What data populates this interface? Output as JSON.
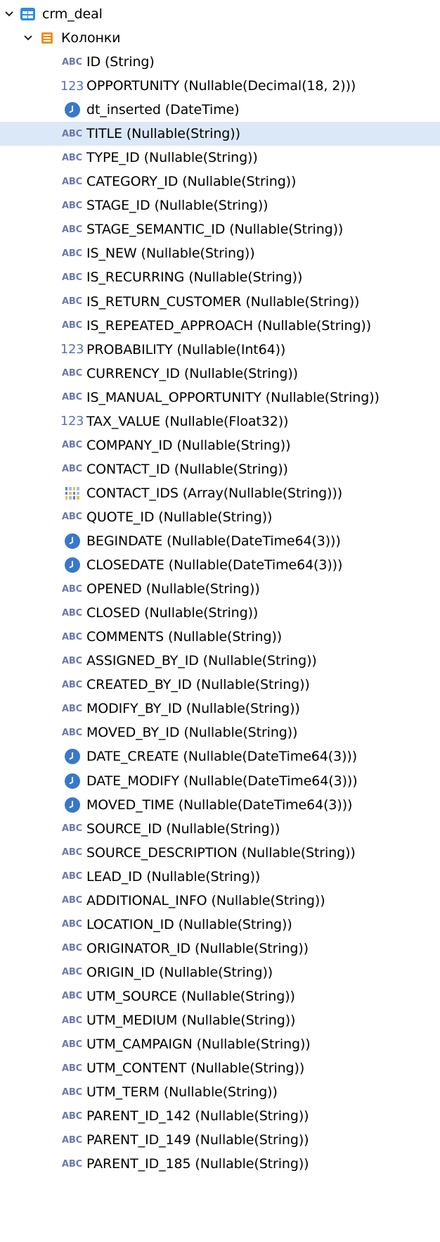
{
  "tree": {
    "root": {
      "label": "crm_deal",
      "icon": "table-icon",
      "expanded": true
    },
    "folder": {
      "label": "Колонки",
      "icon": "columns-folder-icon",
      "expanded": true
    },
    "selected_column": "TITLE (Nullable(String))",
    "columns": [
      {
        "type_icon": "string-icon",
        "type_text": "ABC",
        "label": "ID (String)"
      },
      {
        "type_icon": "number-icon",
        "type_text": "123",
        "label": "OPPORTUNITY (Nullable(Decimal(18, 2)))"
      },
      {
        "type_icon": "datetime-icon",
        "type_text": "",
        "label": "dt_inserted (DateTime)"
      },
      {
        "type_icon": "string-icon",
        "type_text": "ABC",
        "label": "TITLE (Nullable(String))"
      },
      {
        "type_icon": "string-icon",
        "type_text": "ABC",
        "label": "TYPE_ID (Nullable(String))"
      },
      {
        "type_icon": "string-icon",
        "type_text": "ABC",
        "label": "CATEGORY_ID (Nullable(String))"
      },
      {
        "type_icon": "string-icon",
        "type_text": "ABC",
        "label": "STAGE_ID (Nullable(String))"
      },
      {
        "type_icon": "string-icon",
        "type_text": "ABC",
        "label": "STAGE_SEMANTIC_ID (Nullable(String))"
      },
      {
        "type_icon": "string-icon",
        "type_text": "ABC",
        "label": "IS_NEW (Nullable(String))"
      },
      {
        "type_icon": "string-icon",
        "type_text": "ABC",
        "label": "IS_RECURRING (Nullable(String))"
      },
      {
        "type_icon": "string-icon",
        "type_text": "ABC",
        "label": "IS_RETURN_CUSTOMER (Nullable(String))"
      },
      {
        "type_icon": "string-icon",
        "type_text": "ABC",
        "label": "IS_REPEATED_APPROACH (Nullable(String))"
      },
      {
        "type_icon": "number-icon",
        "type_text": "123",
        "label": "PROBABILITY (Nullable(Int64))"
      },
      {
        "type_icon": "string-icon",
        "type_text": "ABC",
        "label": "CURRENCY_ID (Nullable(String))"
      },
      {
        "type_icon": "string-icon",
        "type_text": "ABC",
        "label": "IS_MANUAL_OPPORTUNITY (Nullable(String))"
      },
      {
        "type_icon": "number-icon",
        "type_text": "123",
        "label": "TAX_VALUE (Nullable(Float32))"
      },
      {
        "type_icon": "string-icon",
        "type_text": "ABC",
        "label": "COMPANY_ID (Nullable(String))"
      },
      {
        "type_icon": "string-icon",
        "type_text": "ABC",
        "label": "CONTACT_ID (Nullable(String))"
      },
      {
        "type_icon": "array-icon",
        "type_text": "",
        "label": "CONTACT_IDS (Array(Nullable(String)))"
      },
      {
        "type_icon": "string-icon",
        "type_text": "ABC",
        "label": "QUOTE_ID (Nullable(String))"
      },
      {
        "type_icon": "datetime-icon",
        "type_text": "",
        "label": "BEGINDATE (Nullable(DateTime64(3)))"
      },
      {
        "type_icon": "datetime-icon",
        "type_text": "",
        "label": "CLOSEDATE (Nullable(DateTime64(3)))"
      },
      {
        "type_icon": "string-icon",
        "type_text": "ABC",
        "label": "OPENED (Nullable(String))"
      },
      {
        "type_icon": "string-icon",
        "type_text": "ABC",
        "label": "CLOSED (Nullable(String))"
      },
      {
        "type_icon": "string-icon",
        "type_text": "ABC",
        "label": "COMMENTS (Nullable(String))"
      },
      {
        "type_icon": "string-icon",
        "type_text": "ABC",
        "label": "ASSIGNED_BY_ID (Nullable(String))"
      },
      {
        "type_icon": "string-icon",
        "type_text": "ABC",
        "label": "CREATED_BY_ID (Nullable(String))"
      },
      {
        "type_icon": "string-icon",
        "type_text": "ABC",
        "label": "MODIFY_BY_ID (Nullable(String))"
      },
      {
        "type_icon": "string-icon",
        "type_text": "ABC",
        "label": "MOVED_BY_ID (Nullable(String))"
      },
      {
        "type_icon": "datetime-icon",
        "type_text": "",
        "label": "DATE_CREATE (Nullable(DateTime64(3)))"
      },
      {
        "type_icon": "datetime-icon",
        "type_text": "",
        "label": "DATE_MODIFY (Nullable(DateTime64(3)))"
      },
      {
        "type_icon": "datetime-icon",
        "type_text": "",
        "label": "MOVED_TIME (Nullable(DateTime64(3)))"
      },
      {
        "type_icon": "string-icon",
        "type_text": "ABC",
        "label": "SOURCE_ID (Nullable(String))"
      },
      {
        "type_icon": "string-icon",
        "type_text": "ABC",
        "label": "SOURCE_DESCRIPTION (Nullable(String))"
      },
      {
        "type_icon": "string-icon",
        "type_text": "ABC",
        "label": "LEAD_ID (Nullable(String))"
      },
      {
        "type_icon": "string-icon",
        "type_text": "ABC",
        "label": "ADDITIONAL_INFO (Nullable(String))"
      },
      {
        "type_icon": "string-icon",
        "type_text": "ABC",
        "label": "LOCATION_ID (Nullable(String))"
      },
      {
        "type_icon": "string-icon",
        "type_text": "ABC",
        "label": "ORIGINATOR_ID (Nullable(String))"
      },
      {
        "type_icon": "string-icon",
        "type_text": "ABC",
        "label": "ORIGIN_ID (Nullable(String))"
      },
      {
        "type_icon": "string-icon",
        "type_text": "ABC",
        "label": "UTM_SOURCE (Nullable(String))"
      },
      {
        "type_icon": "string-icon",
        "type_text": "ABC",
        "label": "UTM_MEDIUM (Nullable(String))"
      },
      {
        "type_icon": "string-icon",
        "type_text": "ABC",
        "label": "UTM_CAMPAIGN (Nullable(String))"
      },
      {
        "type_icon": "string-icon",
        "type_text": "ABC",
        "label": "UTM_CONTENT (Nullable(String))"
      },
      {
        "type_icon": "string-icon",
        "type_text": "ABC",
        "label": "UTM_TERM (Nullable(String))"
      },
      {
        "type_icon": "string-icon",
        "type_text": "ABC",
        "label": "PARENT_ID_142 (Nullable(String))"
      },
      {
        "type_icon": "string-icon",
        "type_text": "ABC",
        "label": "PARENT_ID_149 (Nullable(String))"
      },
      {
        "type_icon": "string-icon",
        "type_text": "ABC",
        "label": "PARENT_ID_185 (Nullable(String))"
      }
    ]
  }
}
